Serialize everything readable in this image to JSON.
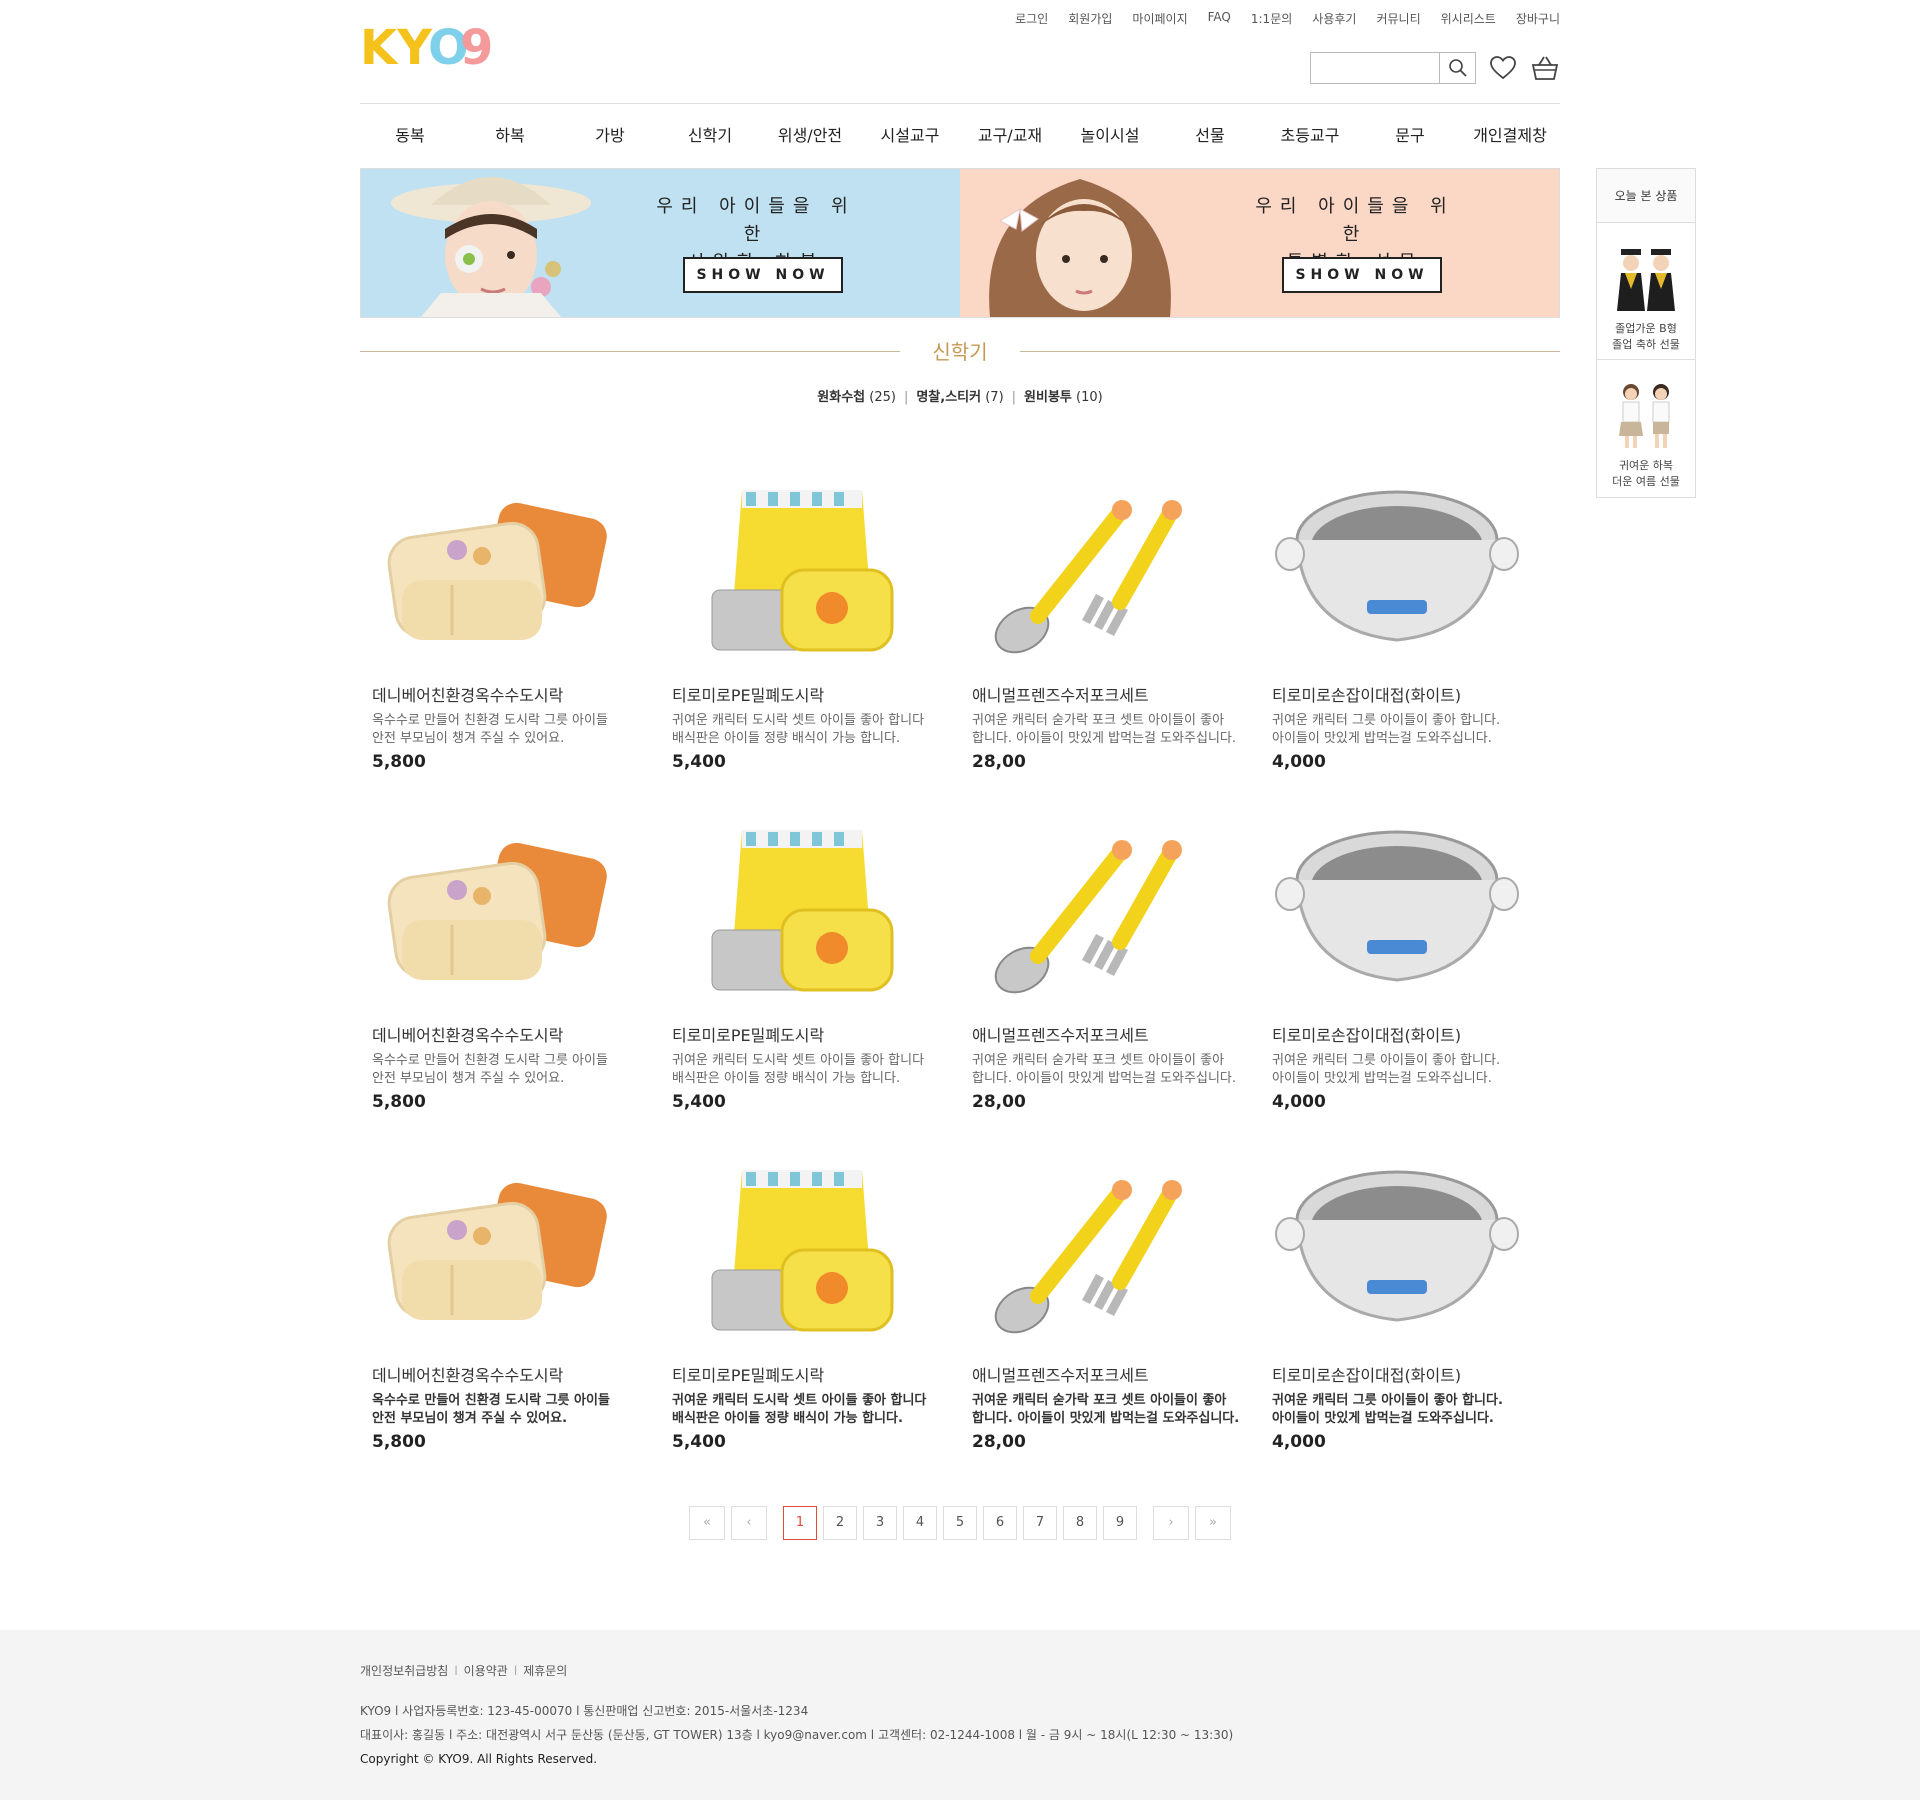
{
  "header": {
    "logo_text": "KYO9",
    "util_links": [
      "로그인",
      "회원가입",
      "마이페이지",
      "FAQ",
      "1:1문의",
      "사용후기",
      "커뮤니티",
      "위시리스트",
      "장바구니"
    ],
    "search": {
      "placeholder": "",
      "value": ""
    }
  },
  "nav": {
    "items": [
      "동복",
      "하복",
      "가방",
      "신학기",
      "위생/안전",
      "시설교구",
      "교구/교재",
      "놀이시설",
      "선물",
      "초등교구",
      "문구",
      "개인결제창"
    ]
  },
  "banners": [
    {
      "line1": "우리 아이들을 위한",
      "line2": "시원한 하복",
      "button": "SHOW NOW",
      "color": "#bfe1f1"
    },
    {
      "line1": "우리 아이들을 위한",
      "line2": "특별한 선물",
      "button": "SHOW NOW",
      "color": "#fbd7c6"
    }
  ],
  "section": {
    "title": "신학기",
    "subcategories": [
      {
        "name": "원화수첩",
        "count": "(25)"
      },
      {
        "name": "명찰,스티커",
        "count": "(7)"
      },
      {
        "name": "원비봉투",
        "count": "(10)"
      }
    ]
  },
  "products": [
    {
      "name": "데니베어친환경옥수수도시락",
      "desc1": "옥수수로 만들어 친환경 도시락 그릇 아이들",
      "desc2": "안전 부모님이 챙겨 주실 수 있어요.",
      "price": "5,800",
      "icon": "lunchbox-image"
    },
    {
      "name": "티로미로PE밀폐도시락",
      "desc1": "귀여운 캐릭터 도시락 셋트 아이들 좋아 합니다",
      "desc2": "배식판은 아이들 정량 배식이 가능 합니다.",
      "price": "5,400",
      "icon": "lunch-set-image"
    },
    {
      "name": "애니멀프렌즈수저포크세트",
      "desc1": "귀여운 캐릭터 숟가락 포크 셋트 아이들이 좋아",
      "desc2": "합니다. 아이들이 맛있게 밥먹는걸 도와주십니다.",
      "price": "28,00",
      "icon": "spoon-fork-image"
    },
    {
      "name": "티로미로손잡이대접(화이트)",
      "desc1": "귀여운 캐릭터 그릇 아이들이 좋아 합니다.",
      "desc2": "아이들이 맛있게 밥먹는걸 도와주십니다.",
      "price": "4,000",
      "icon": "bowl-image"
    }
  ],
  "pagination": {
    "first": "«",
    "prev": "‹",
    "next": "›",
    "last": "»",
    "pages": [
      "1",
      "2",
      "3",
      "4",
      "5",
      "6",
      "7",
      "8",
      "9"
    ],
    "current": "1"
  },
  "side_widget": {
    "title": "오늘 본 상품",
    "items": [
      {
        "line1": "졸업가운 B형",
        "line2": "졸업 축하 선물"
      },
      {
        "line1": "귀여운 하복",
        "line2": "더운 여름 선물"
      }
    ]
  },
  "footer": {
    "links": [
      "개인정보취급방침",
      "이용약관",
      "제휴문의"
    ],
    "info_line1": "KYO9  l  사업자등록번호: 123-45-00070  l  통신판매업 신고번호: 2015-서울서초-1234",
    "info_line2": "대표이사: 홍길동  l  주소: 대전광역시 서구 둔산동 (둔산동, GT TOWER) 13층  l  kyo9@naver.com  l  고객센터: 02-1244-1008  l  월 - 금 9시 ~ 18시(L 12:30 ~ 13:30)",
    "copyright": "Copyright © KYO9. All Rights Reserved."
  },
  "colors": {
    "accent_gold": "#c49a52",
    "active_page": "#e24a3b",
    "banner_blue": "#bfe1f1",
    "banner_pink": "#fbd7c6"
  }
}
